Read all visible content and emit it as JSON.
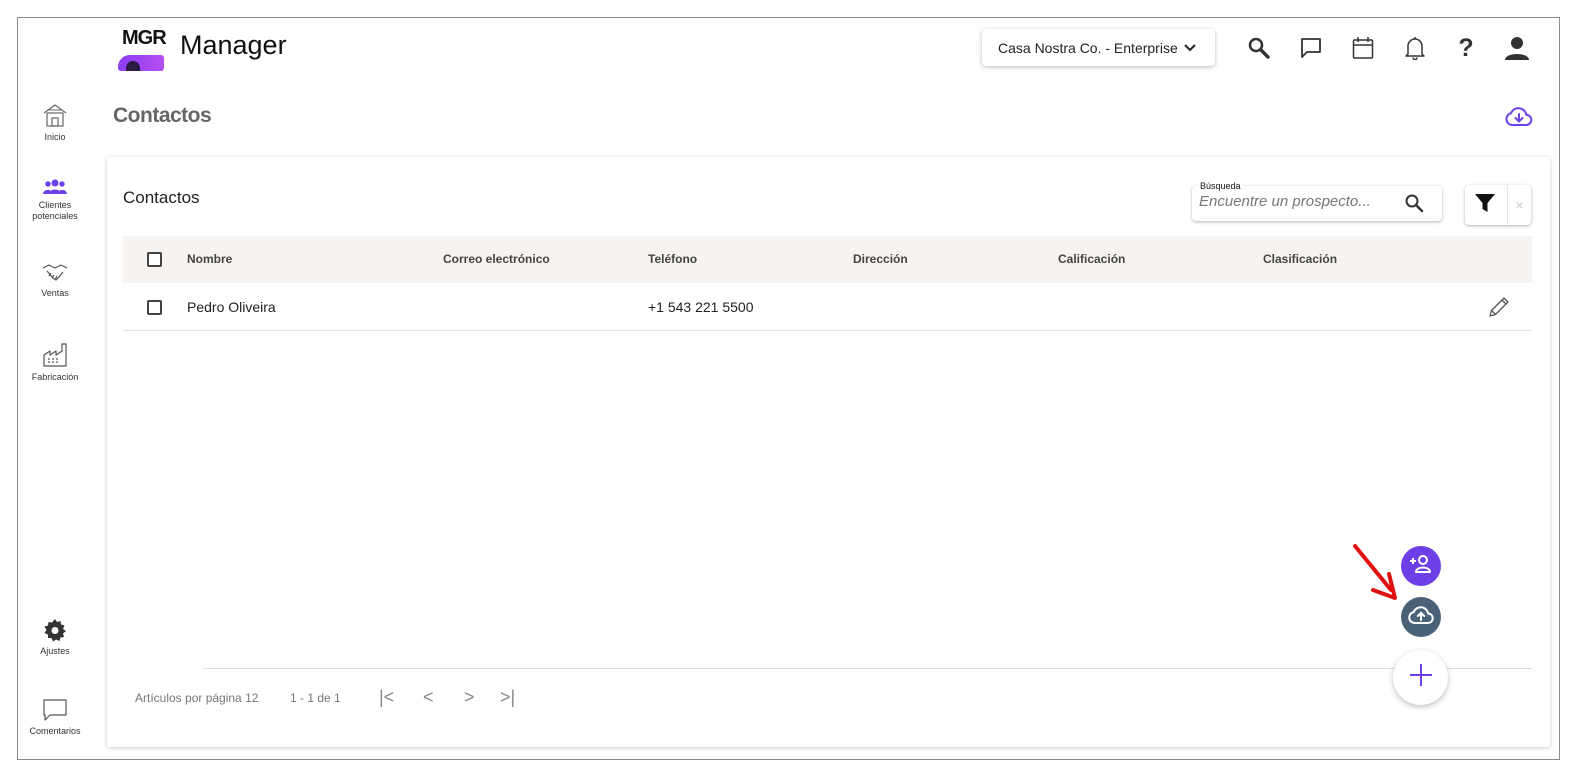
{
  "app": {
    "logo_text": "MGR",
    "title": "Manager"
  },
  "header": {
    "company": "Casa Nostra Co. - Enterprise",
    "icons": [
      "search-icon",
      "chat-icon",
      "calendar-icon",
      "bell-icon",
      "help-icon",
      "user-icon"
    ],
    "help_glyph": "?"
  },
  "sidebar": {
    "items": [
      {
        "label": "Inicio",
        "icon": "home-icon"
      },
      {
        "label": "Clientes potenciales",
        "icon": "people-icon",
        "active": true
      },
      {
        "label": "Ventas",
        "icon": "handshake-icon"
      },
      {
        "label": "Fabricación",
        "icon": "factory-icon"
      }
    ],
    "bottom": [
      {
        "label": "Ajustes",
        "icon": "gear-icon"
      },
      {
        "label": "Comentarios",
        "icon": "comment-icon"
      }
    ]
  },
  "page": {
    "title": "Contactos"
  },
  "card": {
    "title": "Contactos",
    "search": {
      "label": "Búsqueda",
      "placeholder": "Encuentre un prospecto..."
    },
    "filter_clear": "×"
  },
  "table": {
    "columns": [
      "Nombre",
      "Correo electrónico",
      "Teléfono",
      "Dirección",
      "Calificación",
      "Clasificación"
    ],
    "rows": [
      {
        "name": "Pedro Oliveira",
        "email": "",
        "phone": "+1 543 221 5500",
        "address": "",
        "rating": "",
        "classification": ""
      }
    ]
  },
  "pagination": {
    "per_page_label": "Artículos por página 12",
    "range": "1 - 1 de 1",
    "first": "|<",
    "prev": "<",
    "next": ">",
    "last": ">|"
  },
  "colors": {
    "accent": "#6c40e6",
    "upload_fab": "#4a6278",
    "arrow": "#e01010"
  }
}
